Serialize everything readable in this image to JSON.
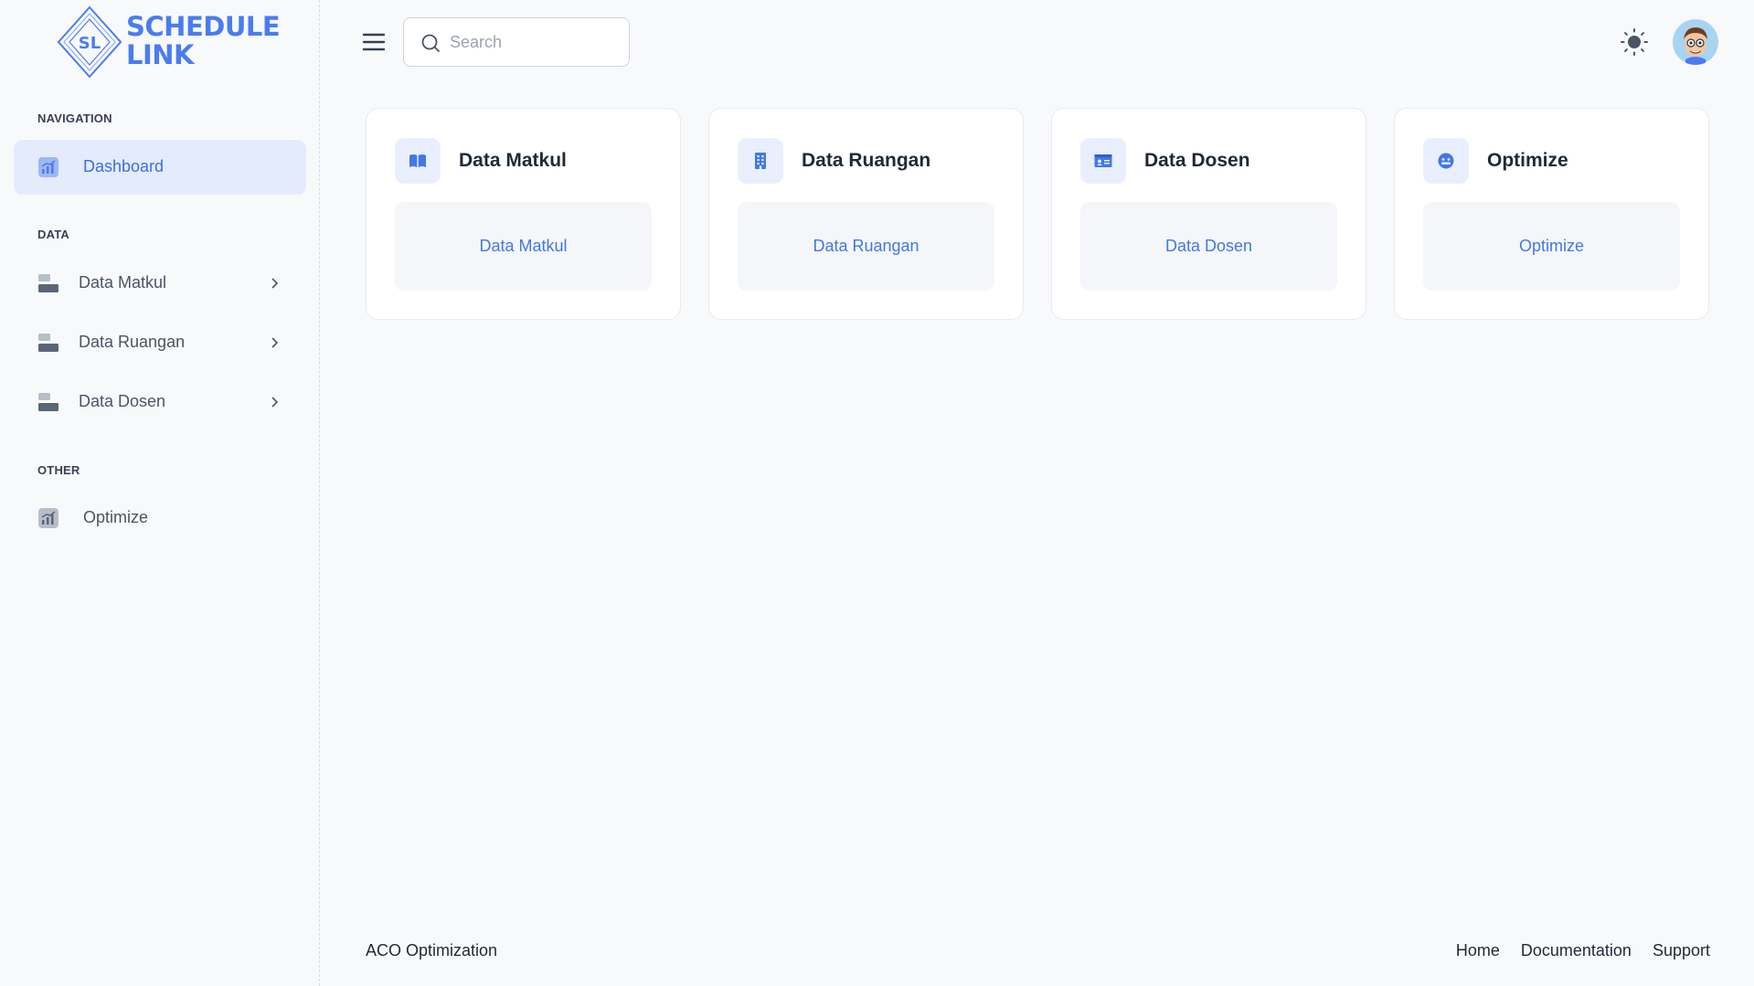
{
  "brand": {
    "logo_letters": "SL",
    "line1": "SCHEDULE",
    "line2": "LINK",
    "color": "#4a7cf0"
  },
  "sidebar": {
    "sections": [
      {
        "title": "NAVIGATION"
      },
      {
        "title": "DATA"
      },
      {
        "title": "OTHER"
      }
    ],
    "items": [
      {
        "label": "Dashboard",
        "icon": "chart-icon",
        "active": true
      },
      {
        "label": "Data Matkul",
        "icon": "stack-icon",
        "has_submenu": true
      },
      {
        "label": "Data Ruangan",
        "icon": "stack-icon",
        "has_submenu": true
      },
      {
        "label": "Data Dosen",
        "icon": "stack-icon",
        "has_submenu": true
      },
      {
        "label": "Optimize",
        "icon": "chart-icon"
      }
    ]
  },
  "header": {
    "menu_icon": "hamburger-icon",
    "search": {
      "placeholder": "Search",
      "value": ""
    },
    "theme_icon": "sun-icon",
    "avatar_icon": "avatar-icon"
  },
  "cards": [
    {
      "title": "Data Matkul",
      "icon": "book-icon",
      "button": "Data Matkul"
    },
    {
      "title": "Data Ruangan",
      "icon": "building-icon",
      "button": "Data Ruangan"
    },
    {
      "title": "Data Dosen",
      "icon": "id-card-icon",
      "button": "Data Dosen"
    },
    {
      "title": "Optimize",
      "icon": "face-icon",
      "button": "Optimize"
    }
  ],
  "footer": {
    "left": "ACO Optimization",
    "links": [
      "Home",
      "Documentation",
      "Support"
    ]
  },
  "colors": {
    "accent": "#4278e3",
    "active_bg": "#e4ebfb",
    "icon_bg": "#e9effc",
    "page_bg": "#f8f9fb"
  }
}
